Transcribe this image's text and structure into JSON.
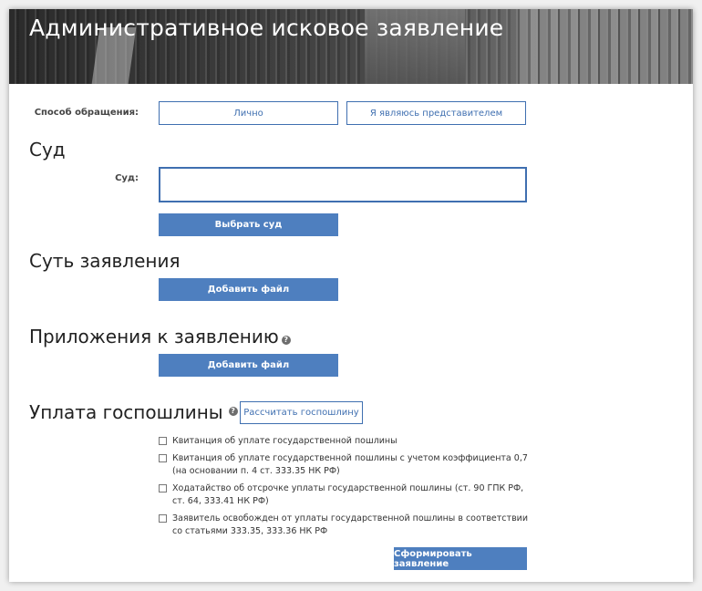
{
  "header": {
    "title": "Административное исковое заявление"
  },
  "method": {
    "label": "Способ обращения:",
    "options": [
      "Лично",
      "Я являюсь представителем"
    ]
  },
  "court": {
    "heading": "Суд",
    "field_label": "Суд:",
    "field_value": "",
    "select_button": "Выбрать суд"
  },
  "essence": {
    "heading": "Суть заявления",
    "add_file": "Добавить файл"
  },
  "attachments": {
    "heading": "Приложения к заявлению",
    "add_file": "Добавить файл"
  },
  "fee": {
    "heading": "Уплата госпошлины",
    "calc_button": "Рассчитать госпошлину",
    "options": [
      "Квитанция об уплате государственной пошлины",
      "Квитанция об уплате государственной пошлины с учетом коэффициента 0,7 (на основании п. 4 ст. 333.35 НК РФ)",
      "Ходатайство об отсрочке уплаты государственной пошлины (ст. 90 ГПК РФ, ст. 64, 333.41 НК РФ)",
      "Заявитель освобожден от уплаты государственной пошлины в соответствии со статьями 333.35, 333.36 НК РФ"
    ]
  },
  "submit": {
    "label": "Сформировать заявление"
  },
  "colors": {
    "accent": "#4e7fbf",
    "border": "#3f6fb0",
    "text": "#222222"
  },
  "icons": {
    "help": "question-circle-icon"
  }
}
